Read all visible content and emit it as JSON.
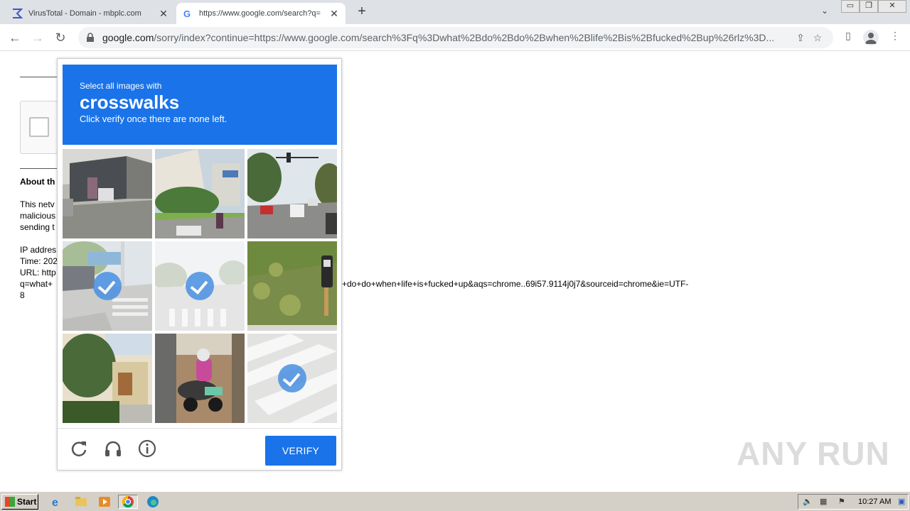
{
  "tabs": [
    {
      "title": "VirusTotal - Domain - mbplc.com",
      "icon": "virustotal-icon"
    },
    {
      "title": "https://www.google.com/search?q=",
      "icon": "google-icon"
    }
  ],
  "address_bar": {
    "host": "google.com",
    "path": "/sorry/index?continue=https://www.google.com/search%3Fq%3Dwhat%2Bdo%2Bdo%2Bwhen%2Blife%2Bis%2Bfucked%2Bup%26rlz%3D..."
  },
  "page": {
    "about_heading": "About th",
    "para_lines": [
      "This netv",
      "malicious",
      "sending t"
    ],
    "ip_line": "IP addres",
    "time_line": "Time: 202",
    "url_line": "URL: http",
    "q_line": "q=what+",
    "url_tail": "+do+do+when+life+is+fucked+up&aqs=chrome..69i57.9114j0j7&sourceid=chrome&ie=UTF-",
    "last_line": "8"
  },
  "captcha": {
    "line1": "Select all images with",
    "target": "crosswalks",
    "line3": "Click verify once there are none left.",
    "verify_label": "VERIFY",
    "tiles": [
      {
        "scene": "warehouse-street",
        "selected": false
      },
      {
        "scene": "street-motorbike",
        "selected": false
      },
      {
        "scene": "traffic-road",
        "selected": false
      },
      {
        "scene": "crosswalk-corner",
        "selected": true
      },
      {
        "scene": "faded-crosswalk",
        "selected": true
      },
      {
        "scene": "parking-meter-grass",
        "selected": false
      },
      {
        "scene": "house-tree",
        "selected": false
      },
      {
        "scene": "motorcyclist",
        "selected": false
      },
      {
        "scene": "crosswalk-closeup",
        "selected": true
      }
    ]
  },
  "watermark": "ANY RUN",
  "taskbar": {
    "start_label": "Start",
    "clock": "10:27 AM"
  },
  "colors": {
    "accent": "#1a73e8",
    "tabstrip": "#dee1e6",
    "taskbar": "#d4d0c8"
  }
}
